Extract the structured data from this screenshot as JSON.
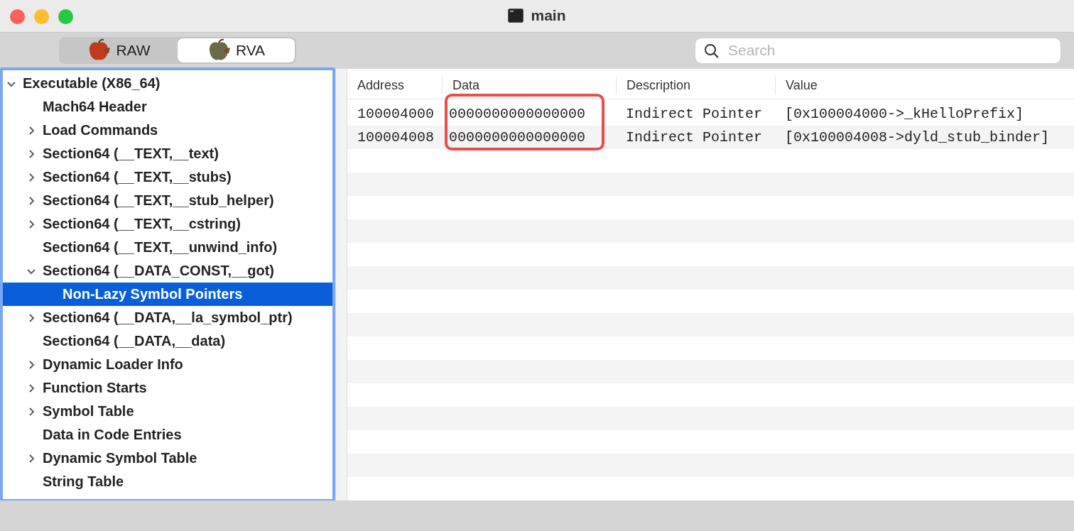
{
  "window": {
    "title": "main"
  },
  "view_modes": [
    {
      "label": "RAW",
      "selected": false
    },
    {
      "label": "RVA",
      "selected": true
    }
  ],
  "search": {
    "placeholder": "Search"
  },
  "tree": [
    {
      "label": "Executable  (X86_64)",
      "expanded": true,
      "selected": false,
      "children": [
        {
          "label": "Mach64 Header",
          "selected": false
        },
        {
          "label": "Load Commands",
          "expanded": false,
          "selected": false
        },
        {
          "label": "Section64 (__TEXT,__text)",
          "expanded": false,
          "selected": false
        },
        {
          "label": "Section64 (__TEXT,__stubs)",
          "expanded": false,
          "selected": false
        },
        {
          "label": "Section64 (__TEXT,__stub_helper)",
          "expanded": false,
          "selected": false
        },
        {
          "label": "Section64 (__TEXT,__cstring)",
          "expanded": false,
          "selected": false
        },
        {
          "label": "Section64 (__TEXT,__unwind_info)",
          "selected": false
        },
        {
          "label": "Section64 (__DATA_CONST,__got)",
          "expanded": true,
          "selected": false,
          "children": [
            {
              "label": "Non-Lazy Symbol Pointers",
              "selected": true
            }
          ]
        },
        {
          "label": "Section64 (__DATA,__la_symbol_ptr)",
          "expanded": false,
          "selected": false
        },
        {
          "label": "Section64 (__DATA,__data)",
          "selected": false
        },
        {
          "label": "Dynamic Loader Info",
          "expanded": false,
          "selected": false
        },
        {
          "label": "Function Starts",
          "expanded": false,
          "selected": false
        },
        {
          "label": "Symbol Table",
          "expanded": false,
          "selected": false
        },
        {
          "label": "Data in Code Entries",
          "selected": false
        },
        {
          "label": "Dynamic Symbol Table",
          "expanded": false,
          "selected": false
        },
        {
          "label": "String Table",
          "selected": false
        }
      ]
    }
  ],
  "table": {
    "columns": [
      {
        "label": "Address",
        "highlighted": false
      },
      {
        "label": "Data",
        "highlighted": true
      },
      {
        "label": "Description",
        "highlighted": false
      },
      {
        "label": "Value",
        "highlighted": false
      }
    ],
    "rows": [
      [
        "100004000",
        "0000000000000000",
        "Indirect Pointer",
        "[0x100004000->_kHelloPrefix]"
      ],
      [
        "100004008",
        "0000000000000000",
        "Indirect Pointer",
        "[0x100004008->dyld_stub_binder]"
      ]
    ]
  }
}
